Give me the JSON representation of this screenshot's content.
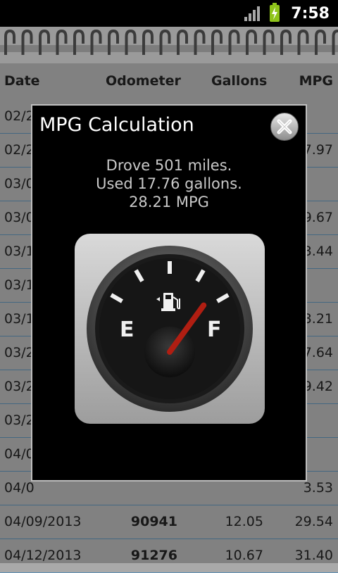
{
  "status_bar": {
    "time": "7:58",
    "signal_icon": "signal-icon",
    "battery_icon": "battery-charging-icon"
  },
  "table": {
    "headers": {
      "date": "Date",
      "odometer": "Odometer",
      "gallons": "Gallons",
      "mpg": "MPG"
    },
    "rows": [
      {
        "date": "02/2",
        "odometer": "",
        "gallons": "",
        "mpg": ""
      },
      {
        "date": "02/2",
        "odometer": "",
        "gallons": "",
        "mpg": "7.97"
      },
      {
        "date": "03/0",
        "odometer": "",
        "gallons": "",
        "mpg": ""
      },
      {
        "date": "03/0",
        "odometer": "",
        "gallons": "",
        "mpg": "9.67"
      },
      {
        "date": "03/1",
        "odometer": "",
        "gallons": "",
        "mpg": "3.44"
      },
      {
        "date": "03/1",
        "odometer": "",
        "gallons": "",
        "mpg": ""
      },
      {
        "date": "03/1",
        "odometer": "",
        "gallons": "",
        "mpg": "3.21"
      },
      {
        "date": "03/2",
        "odometer": "",
        "gallons": "",
        "mpg": "7.64"
      },
      {
        "date": "03/2",
        "odometer": "",
        "gallons": "",
        "mpg": "9.42"
      },
      {
        "date": "03/2",
        "odometer": "",
        "gallons": "",
        "mpg": ""
      },
      {
        "date": "04/0",
        "odometer": "",
        "gallons": "",
        "mpg": ""
      },
      {
        "date": "04/0",
        "odometer": "",
        "gallons": "",
        "mpg": "3.53"
      },
      {
        "date": "04/09/2013",
        "odometer": "90941",
        "gallons": "12.05",
        "mpg": "29.54"
      },
      {
        "date": "04/12/2013",
        "odometer": "91276",
        "gallons": "10.67",
        "mpg": "31.40"
      }
    ]
  },
  "dialog": {
    "title": "MPG Calculation",
    "close_icon": "close-icon",
    "lines": [
      "Drove 501 miles.",
      "Used 17.76 gallons.",
      "28.21 MPG"
    ],
    "gauge": {
      "empty_label": "E",
      "full_label": "F",
      "fuel_level": 0.8,
      "icon": "fuel-pump-icon"
    }
  },
  "colors": {
    "status_bar": "#000000",
    "dialog_bg": "#000000",
    "needle": "#b01e12",
    "row_divider": "#5d8fb3",
    "battery": "#8ec31a"
  }
}
